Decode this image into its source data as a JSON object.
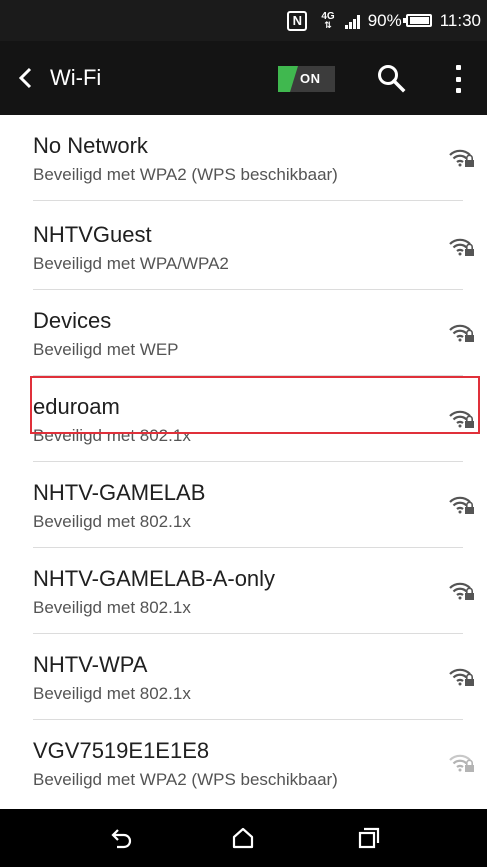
{
  "status_bar": {
    "network_type": "4G",
    "battery_percent": "90%",
    "time": "11:30",
    "icons": [
      "nfc-icon",
      "network-4g-icon",
      "signal-icon",
      "battery-icon"
    ]
  },
  "action_bar": {
    "title": "Wi-Fi",
    "toggle_label": "ON",
    "toggle_state": "on",
    "accent_color": "#40b84f",
    "icons": [
      "back-arrow-icon",
      "search-icon",
      "more-options-icon"
    ]
  },
  "networks": [
    {
      "name": "No Network",
      "security": "Beveiligd met WPA2 (WPS beschikbaar)",
      "signal": "strong",
      "highlighted": false
    },
    {
      "name": "NHTVGuest",
      "security": "Beveiligd met WPA/WPA2",
      "signal": "strong",
      "highlighted": false
    },
    {
      "name": "Devices",
      "security": "Beveiligd met WEP",
      "signal": "strong",
      "highlighted": false
    },
    {
      "name": "eduroam",
      "security": "Beveiligd met 802.1x",
      "signal": "strong",
      "highlighted": true
    },
    {
      "name": "NHTV-GAMELAB",
      "security": "Beveiligd met 802.1x",
      "signal": "strong",
      "highlighted": false
    },
    {
      "name": "NHTV-GAMELAB-A-only",
      "security": "Beveiligd met 802.1x",
      "signal": "strong",
      "highlighted": false
    },
    {
      "name": "NHTV-WPA",
      "security": "Beveiligd met 802.1x",
      "signal": "strong",
      "highlighted": false
    },
    {
      "name": "VGV7519E1E1E8",
      "security": "Beveiligd met WPA2 (WPS beschikbaar)",
      "signal": "weak",
      "highlighted": false
    }
  ],
  "highlight_color": "#e0303a",
  "nav_bar": {
    "icons": [
      "back-icon",
      "home-icon",
      "recents-icon"
    ]
  }
}
